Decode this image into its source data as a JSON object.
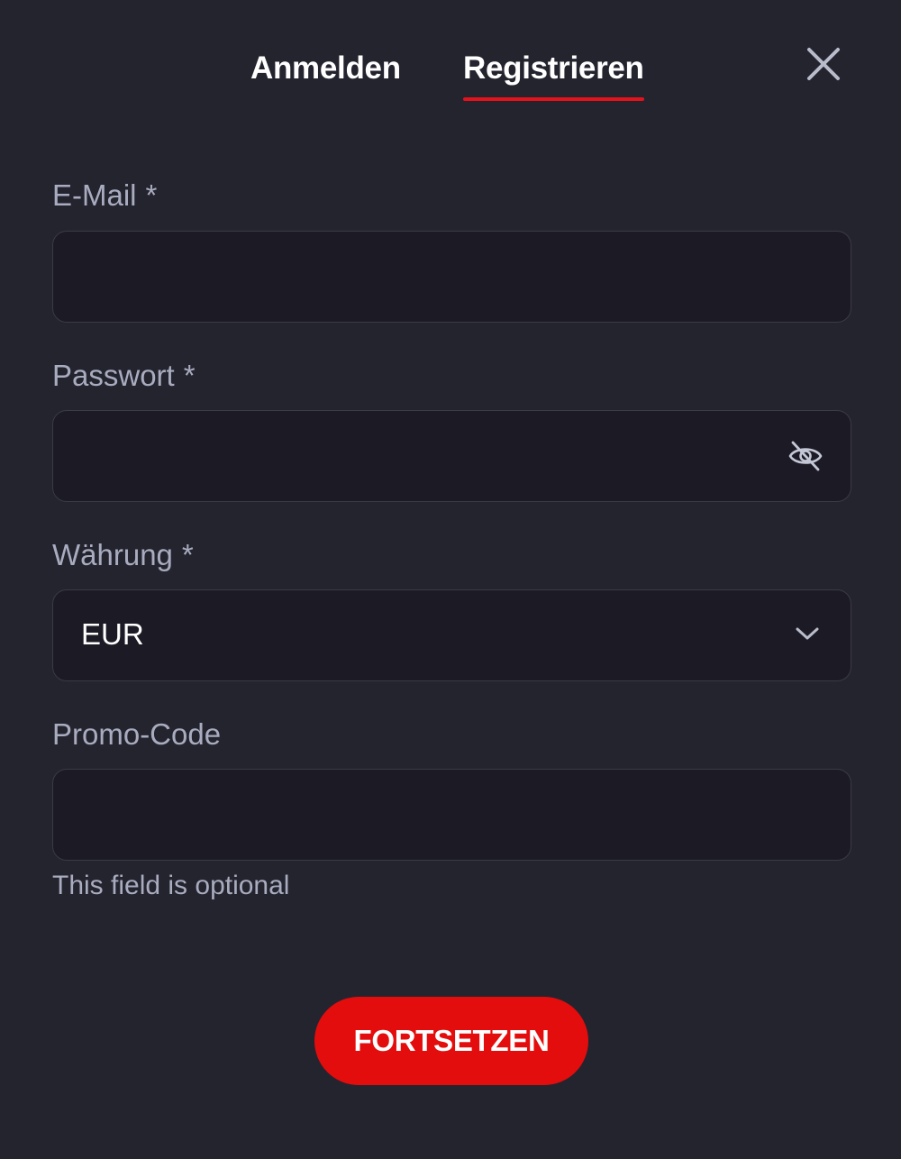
{
  "tabs": {
    "login": "Anmelden",
    "register": "Registrieren",
    "active": "register",
    "accent_color": "#e5121b"
  },
  "close": {
    "icon": "close-icon"
  },
  "form": {
    "email": {
      "label": "E-Mail",
      "required_mark": "*",
      "value": ""
    },
    "password": {
      "label": "Passwort",
      "required_mark": "*",
      "value": "",
      "icon": "eye-off-icon"
    },
    "currency": {
      "label": "Währung",
      "required_mark": "*",
      "selected": "EUR",
      "icon": "chevron-down-icon"
    },
    "promo": {
      "label": "Promo-Code",
      "value": "",
      "helper": "This field is optional"
    }
  },
  "submit": {
    "label": "FORTSETZEN",
    "color": "#e30d0d"
  }
}
